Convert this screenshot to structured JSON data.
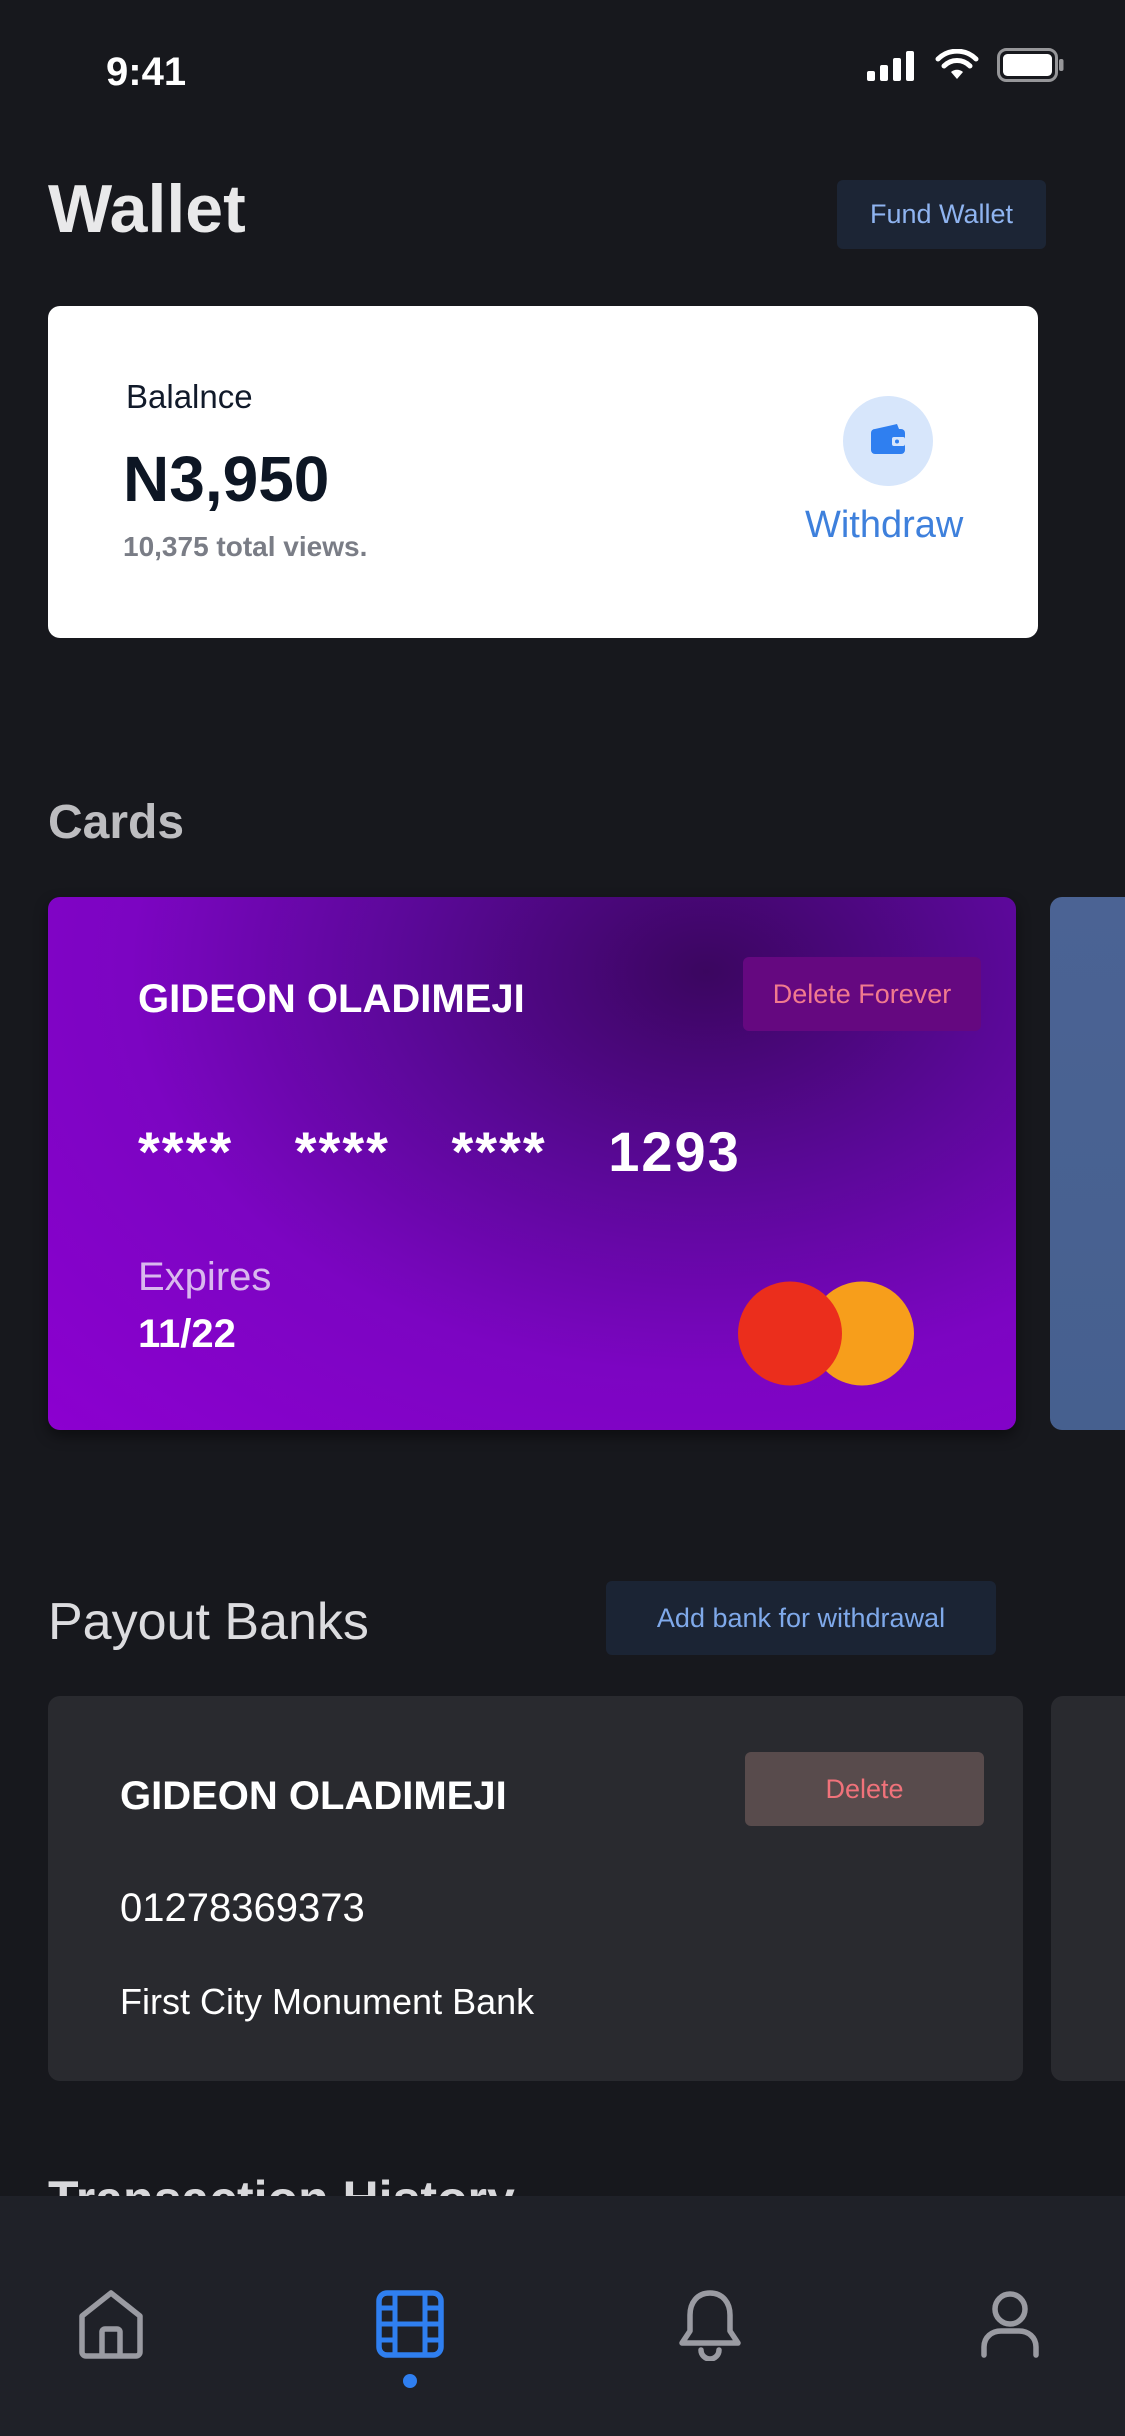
{
  "status_bar": {
    "time": "9:41",
    "icons": [
      "signal-icon",
      "wifi-icon",
      "battery-icon"
    ]
  },
  "header": {
    "title": "Wallet",
    "fund_button": "Fund Wallet"
  },
  "balance": {
    "label": "Balalnce",
    "amount": "N3,950",
    "views": "10,375 total views.",
    "withdraw_label": "Withdraw",
    "withdraw_icon": "wallet-icon"
  },
  "cards_section": {
    "title": "Cards",
    "cards": [
      {
        "holder": "GIDEON OLADIMEJI",
        "delete_label": "Delete Forever",
        "number": "**** **** **** 1293",
        "expires_label": "Expires",
        "expiry": "11/22",
        "brand_icon": "mastercard-icon"
      }
    ]
  },
  "payout_section": {
    "title": "Payout Banks",
    "add_button": "Add bank for withdrawal",
    "banks": [
      {
        "holder": "GIDEON OLADIMEJI",
        "delete_label": "Delete",
        "account_number": "01278369373",
        "bank_name": "First City Monument Bank"
      }
    ]
  },
  "history_section": {
    "title": "Transaction History"
  },
  "tab_bar": {
    "tabs": [
      {
        "icon": "home-icon",
        "active": false
      },
      {
        "icon": "film-icon",
        "active": true
      },
      {
        "icon": "bell-icon",
        "active": false
      },
      {
        "icon": "user-icon",
        "active": false
      }
    ]
  },
  "colors": {
    "background": "#17181d",
    "accent": "#2f7ff0",
    "card_purple": "#8c00d0",
    "danger_text": "#f0727a",
    "mastercard_red": "#eb2e1c",
    "mastercard_orange": "#f79e1b"
  }
}
